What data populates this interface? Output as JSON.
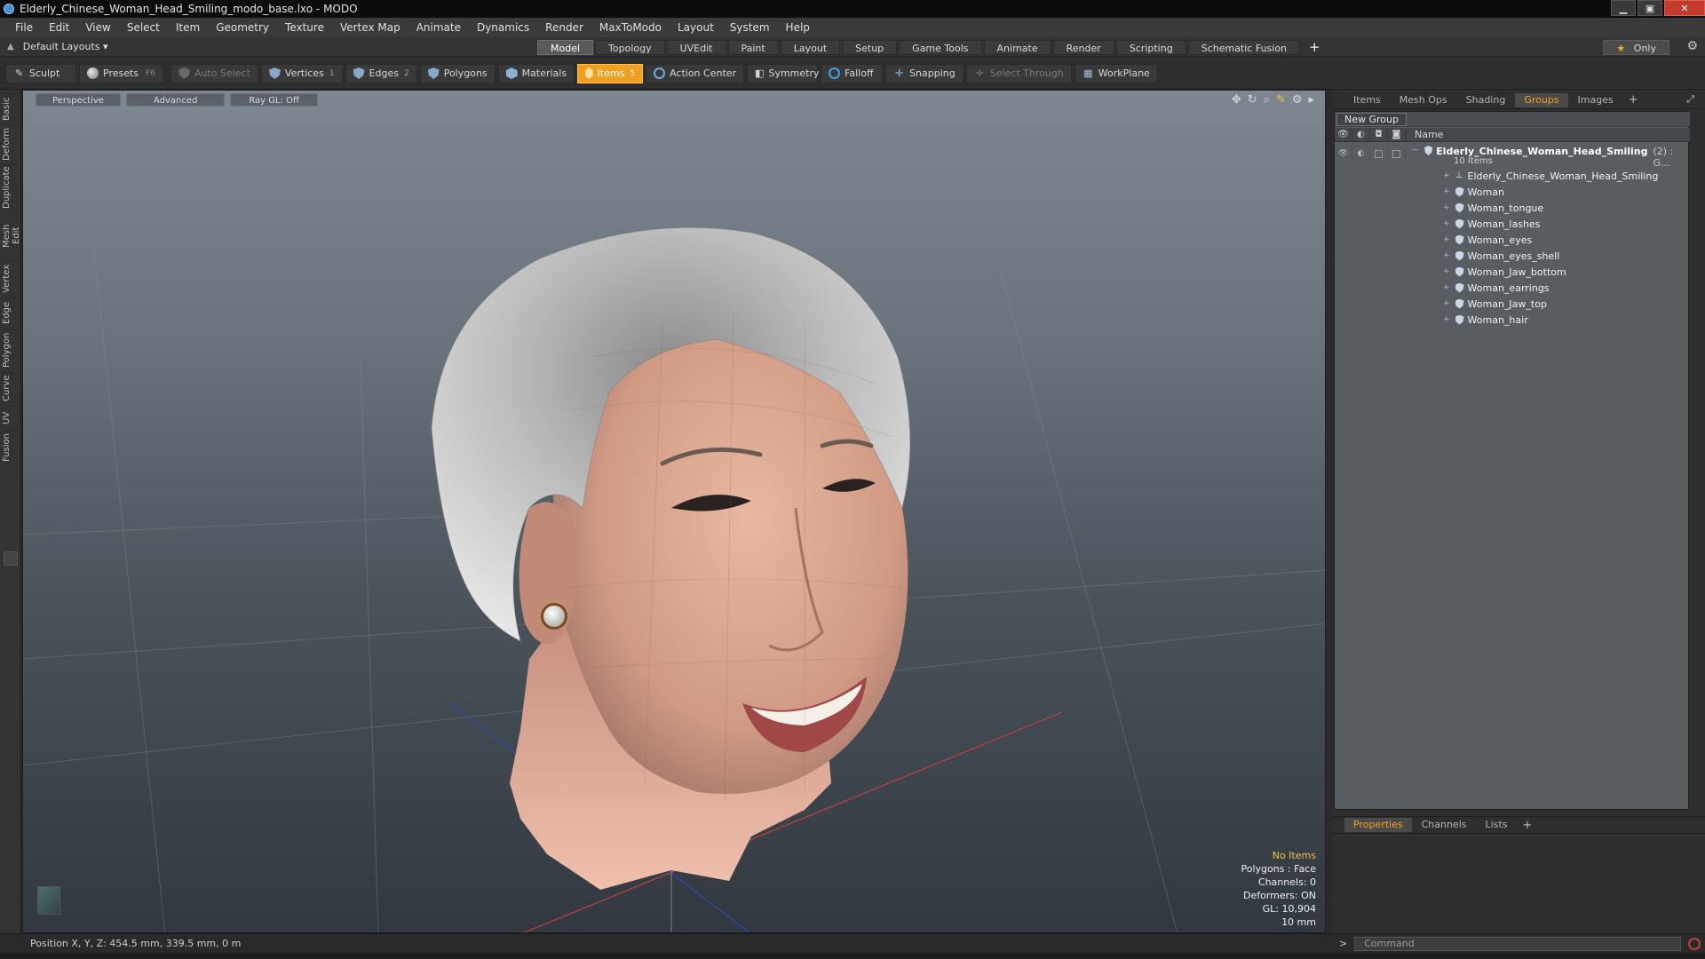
{
  "window": {
    "title": "Elderly_Chinese_Woman_Head_Smiling_modo_base.lxo - MODO",
    "minimize": "▁",
    "maximize": "▣",
    "close": "✕"
  },
  "menu": [
    "File",
    "Edit",
    "View",
    "Select",
    "Item",
    "Geometry",
    "Texture",
    "Vertex Map",
    "Animate",
    "Dynamics",
    "Render",
    "MaxToModo",
    "Layout",
    "System",
    "Help"
  ],
  "layout_bar": {
    "dropdown_label": "Default Layouts ▾",
    "tabs": [
      "Model",
      "Topology",
      "UVEdit",
      "Paint",
      "Layout",
      "Setup",
      "Game Tools",
      "Animate",
      "Render",
      "Scripting",
      "Schematic Fusion"
    ],
    "active_tab": "Model",
    "add_tab": "+",
    "only_label": "Only"
  },
  "toolbar": {
    "sculpt": "Sculpt",
    "presets": "Presets",
    "presets_key": "F6",
    "auto_select": "Auto Select",
    "vertices": "Vertices",
    "vertices_badge": "1",
    "edges": "Edges",
    "edges_badge": "2",
    "polygons": "Polygons",
    "materials": "Materials",
    "items": "Items",
    "items_badge": "5",
    "action_center": "Action Center",
    "symmetry": "Symmetry",
    "falloff": "Falloff",
    "snapping": "Snapping",
    "select_through": "Select Through",
    "workplane": "WorkPlane"
  },
  "left_tabs": [
    "Basic",
    "Deform",
    "Duplicate",
    "Mesh Edit",
    "Vertex",
    "Edge",
    "Polygon",
    "Curve",
    "UV",
    "Fusion"
  ],
  "viewport": {
    "view_mode": "Perspective",
    "shading": "Advanced",
    "raygl": "Ray GL: Off",
    "info": {
      "selection": "No Items",
      "polygons": "Polygons : Face",
      "channels": "Channels: 0",
      "deformers": "Deformers: ON",
      "gl": "GL: 10,904",
      "scale": "10 mm"
    }
  },
  "right_panel": {
    "tabs": [
      "Items",
      "Mesh Ops",
      "Shading",
      "Groups",
      "Images"
    ],
    "active_tab": "Groups",
    "new_group": "New Group",
    "name_header": "Name",
    "group": {
      "name": "Elderly_Chinese_Woman_Head_Smiling",
      "count": "(2) : G...",
      "subtitle": "10 Items"
    },
    "children": [
      {
        "label": "Elderly_Chinese_Woman_Head_Smiling",
        "icon": "locator-icon"
      },
      {
        "label": "Woman",
        "icon": "mesh-icon"
      },
      {
        "label": "Woman_tongue",
        "icon": "mesh-icon"
      },
      {
        "label": "Woman_lashes",
        "icon": "mesh-icon"
      },
      {
        "label": "Woman_eyes",
        "icon": "mesh-icon"
      },
      {
        "label": "Woman_eyes_shell",
        "icon": "mesh-icon"
      },
      {
        "label": "Woman_Jaw_bottom",
        "icon": "mesh-icon"
      },
      {
        "label": "Woman_earrings",
        "icon": "mesh-icon"
      },
      {
        "label": "Woman_Jaw_top",
        "icon": "mesh-icon"
      },
      {
        "label": "Woman_hair",
        "icon": "mesh-icon"
      }
    ],
    "props_tabs": [
      "Properties",
      "Channels",
      "Lists"
    ],
    "props_active": "Properties"
  },
  "status": {
    "position": "Position X, Y, Z:  454.5 mm, 339.5 mm, 0 m",
    "command_placeholder": "Command"
  },
  "colors": {
    "accent": "#f0a020",
    "viewport_top": "#7e8790",
    "viewport_bottom": "#313840"
  }
}
